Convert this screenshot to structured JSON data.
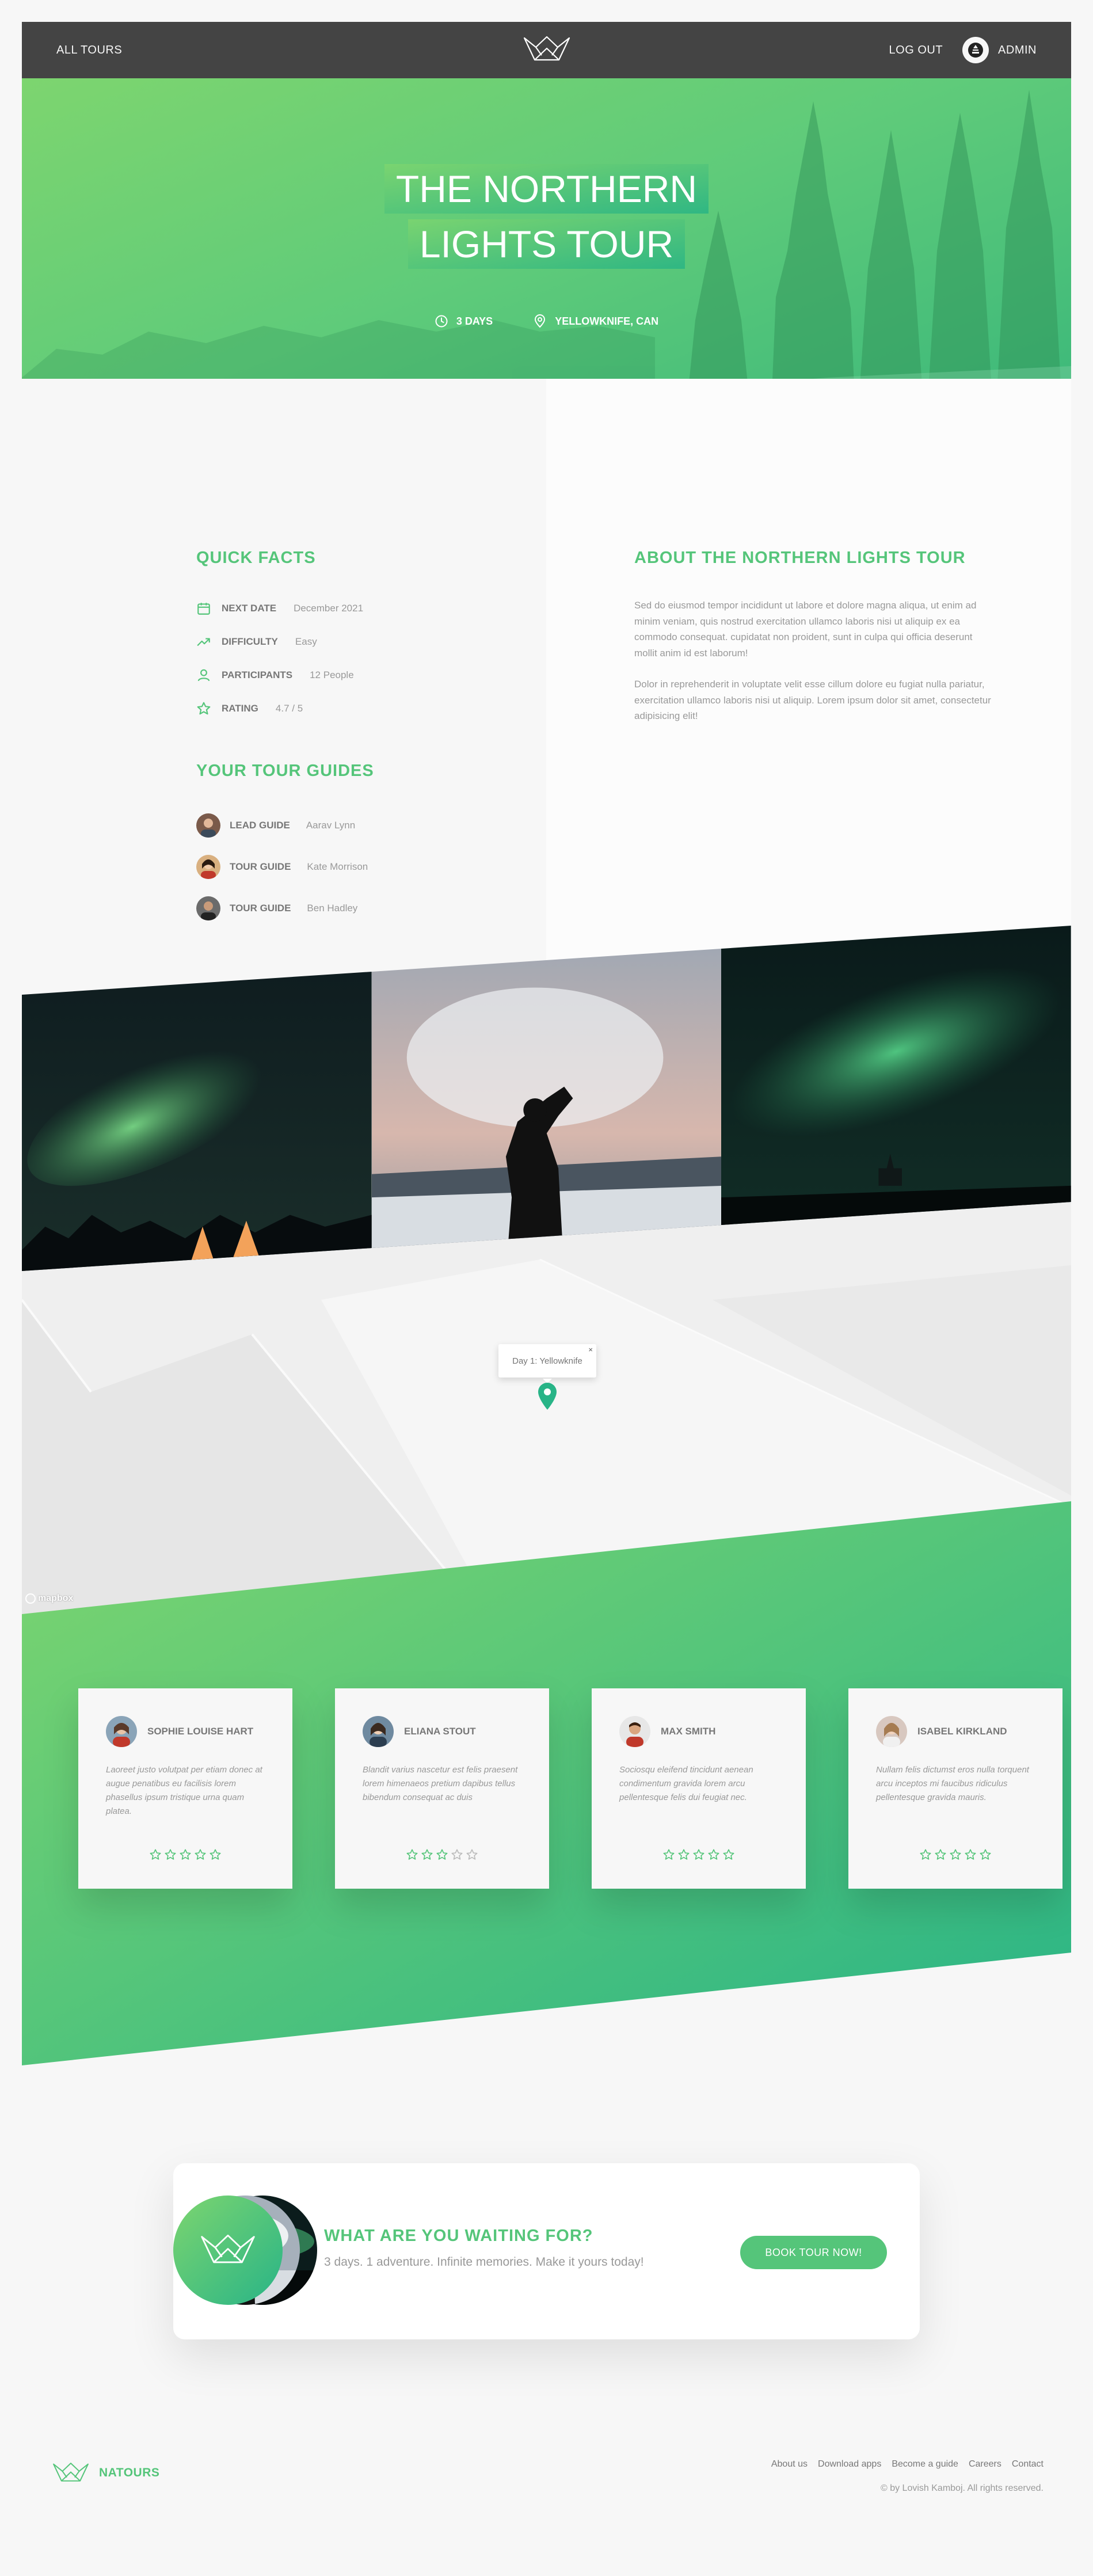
{
  "header": {
    "all_tours": "ALL TOURS",
    "logout": "LOG OUT",
    "user_name": "ADMIN"
  },
  "hero": {
    "title_line1": "THE NORTHERN",
    "title_line2": "LIGHTS TOUR",
    "duration": "3 DAYS",
    "location": "YELLOWKNIFE, CAN"
  },
  "quick_facts": {
    "heading": "QUICK FACTS",
    "facts": [
      {
        "icon": "calendar-icon",
        "label": "NEXT DATE",
        "value": "December 2021"
      },
      {
        "icon": "trending-up-icon",
        "label": "DIFFICULTY",
        "value": "Easy"
      },
      {
        "icon": "user-icon",
        "label": "PARTICIPANTS",
        "value": "12 People"
      },
      {
        "icon": "star-icon",
        "label": "RATING",
        "value": "4.7 / 5"
      }
    ]
  },
  "guides": {
    "heading": "YOUR TOUR GUIDES",
    "items": [
      {
        "role": "LEAD GUIDE",
        "name": "Aarav Lynn"
      },
      {
        "role": "TOUR GUIDE",
        "name": "Kate Morrison"
      },
      {
        "role": "TOUR GUIDE",
        "name": "Ben Hadley"
      }
    ]
  },
  "about": {
    "heading": "ABOUT THE NORTHERN LIGHTS TOUR",
    "paragraph1": "Sed do eiusmod tempor incididunt ut labore et dolore magna aliqua, ut enim ad minim veniam, quis nostrud exercitation ullamco laboris nisi ut aliquip ex ea commodo consequat. cupidatat non proident, sunt in culpa qui officia deserunt mollit anim id est laborum!",
    "paragraph2": "Dolor in reprehenderit in voluptate velit esse cillum dolore eu fugiat nulla pariatur, exercitation ullamco laboris nisi ut aliquip. Lorem ipsum dolor sit amet, consectetur adipisicing elit!"
  },
  "map": {
    "popup": "Day 1: Yellowknife",
    "attribution": "mapbox"
  },
  "reviews": [
    {
      "name": "SOPHIE LOUISE HART",
      "text": "Laoreet justo volutpat per etiam donec at augue penatibus eu facilisis lorem phasellus ipsum tristique urna quam platea.",
      "rating": 5
    },
    {
      "name": "ELIANA STOUT",
      "text": "Blandit varius nascetur est felis praesent lorem himenaeos pretium dapibus tellus bibendum consequat ac duis",
      "rating": 3
    },
    {
      "name": "MAX SMITH",
      "text": "Sociosqu eleifend tincidunt aenean condimentum gravida lorem arcu pellentesque felis dui feugiat nec.",
      "rating": 5
    },
    {
      "name": "ISABEL KIRKLAND",
      "text": "Nullam felis dictumst eros nulla torquent arcu inceptos mi faucibus ridiculus pellentesque gravida mauris.",
      "rating": 5
    }
  ],
  "cta": {
    "heading": "WHAT ARE YOU WAITING FOR?",
    "text": "3 days. 1 adventure. Infinite memories. Make it yours today!",
    "button": "BOOK TOUR NOW!"
  },
  "footer": {
    "brand": "NATOURS",
    "links": [
      "About us",
      "Download apps",
      "Become a guide",
      "Careers",
      "Contact"
    ],
    "copyright": "© by Lovish Kamboj. All rights reserved."
  },
  "colors": {
    "primary": "#55c57a",
    "primary_light": "#7dd56f",
    "primary_dark": "#28b487",
    "header": "#444444"
  }
}
